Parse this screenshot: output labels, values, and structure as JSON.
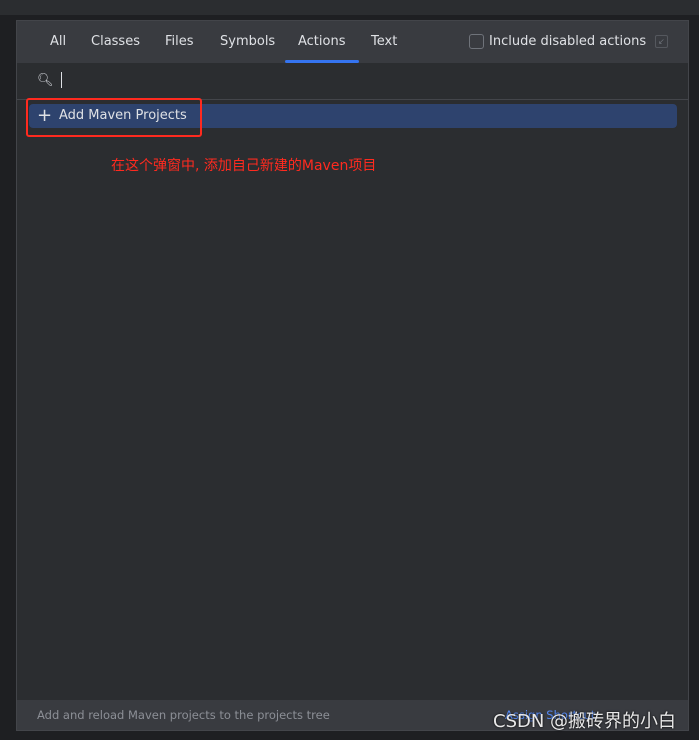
{
  "tabs": [
    "All",
    "Classes",
    "Files",
    "Symbols",
    "Actions",
    "Text"
  ],
  "active_tab": "Actions",
  "include_disabled": {
    "label": "Include disabled actions",
    "checked": false
  },
  "search": {
    "value": ""
  },
  "results": [
    {
      "icon": "plus-icon",
      "label": "Add Maven Projects",
      "selected": true
    }
  ],
  "annotation": "在这个弹窗中, 添加自己新建的Maven项目",
  "footer": {
    "description": "Add and reload Maven projects to the projects tree",
    "link": "Assign Shortcut"
  },
  "watermark": "CSDN @搬砖界的小白",
  "colors": {
    "accent": "#3574f0",
    "selection": "#2e436e",
    "annotation": "#ff2a1f"
  }
}
